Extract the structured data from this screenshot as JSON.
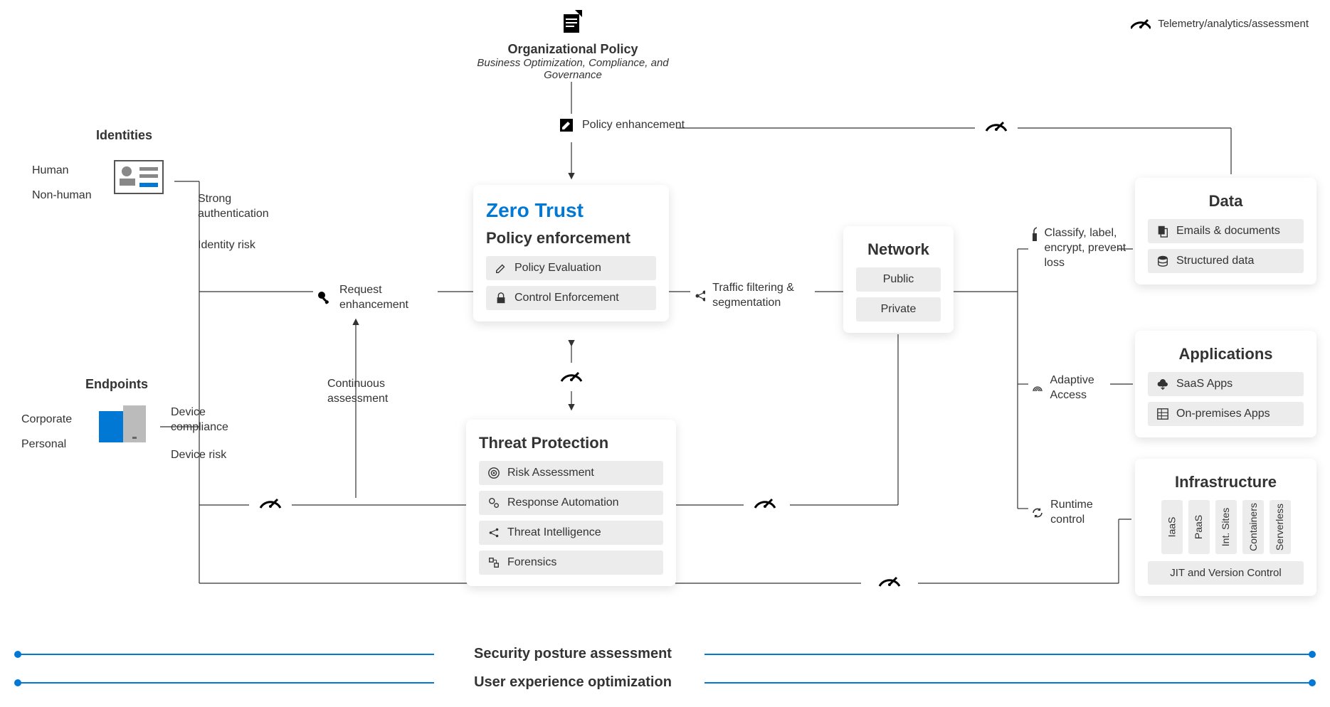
{
  "legend": {
    "telemetry": "Telemetry/analytics/assessment"
  },
  "org": {
    "title": "Organizational Policy",
    "subtitle": "Business Optimization, Compliance, and Governance",
    "policyEnhancement": "Policy enhancement"
  },
  "identities": {
    "heading": "Identities",
    "human": "Human",
    "nonhuman": "Non-human",
    "strongAuth": "Strong authentication",
    "identityRisk": "Identity risk"
  },
  "endpoints": {
    "heading": "Endpoints",
    "corporate": "Corporate",
    "personal": "Personal",
    "deviceCompliance": "Device compliance",
    "deviceRisk": "Device risk"
  },
  "request": {
    "label": "Request enhancement",
    "continuous": "Continuous assessment"
  },
  "zeroTrust": {
    "brand": "Zero Trust",
    "title": "Policy enforcement",
    "policyEval": "Policy Evaluation",
    "controlEnf": "Control Enforcement"
  },
  "threat": {
    "title": "Threat Protection",
    "risk": "Risk Assessment",
    "response": "Response Automation",
    "intel": "Threat Intelligence",
    "forensics": "Forensics"
  },
  "traffic": {
    "label": "Traffic filtering & segmentation"
  },
  "network": {
    "title": "Network",
    "public": "Public",
    "private": "Private"
  },
  "right": {
    "classify": "Classify, label, encrypt, prevent loss",
    "adaptive": "Adaptive Access",
    "runtime": "Runtime control"
  },
  "data": {
    "title": "Data",
    "emails": "Emails & documents",
    "structured": "Structured data"
  },
  "apps": {
    "title": "Applications",
    "saas": "SaaS Apps",
    "onprem": "On-premises Apps"
  },
  "infra": {
    "title": "Infrastructure",
    "cols": [
      "IaaS",
      "PaaS",
      "Int. Sites",
      "Containers",
      "Serverless"
    ],
    "jit": "JIT and Version Control"
  },
  "footer": {
    "security": "Security posture assessment",
    "ux": "User experience optimization"
  }
}
